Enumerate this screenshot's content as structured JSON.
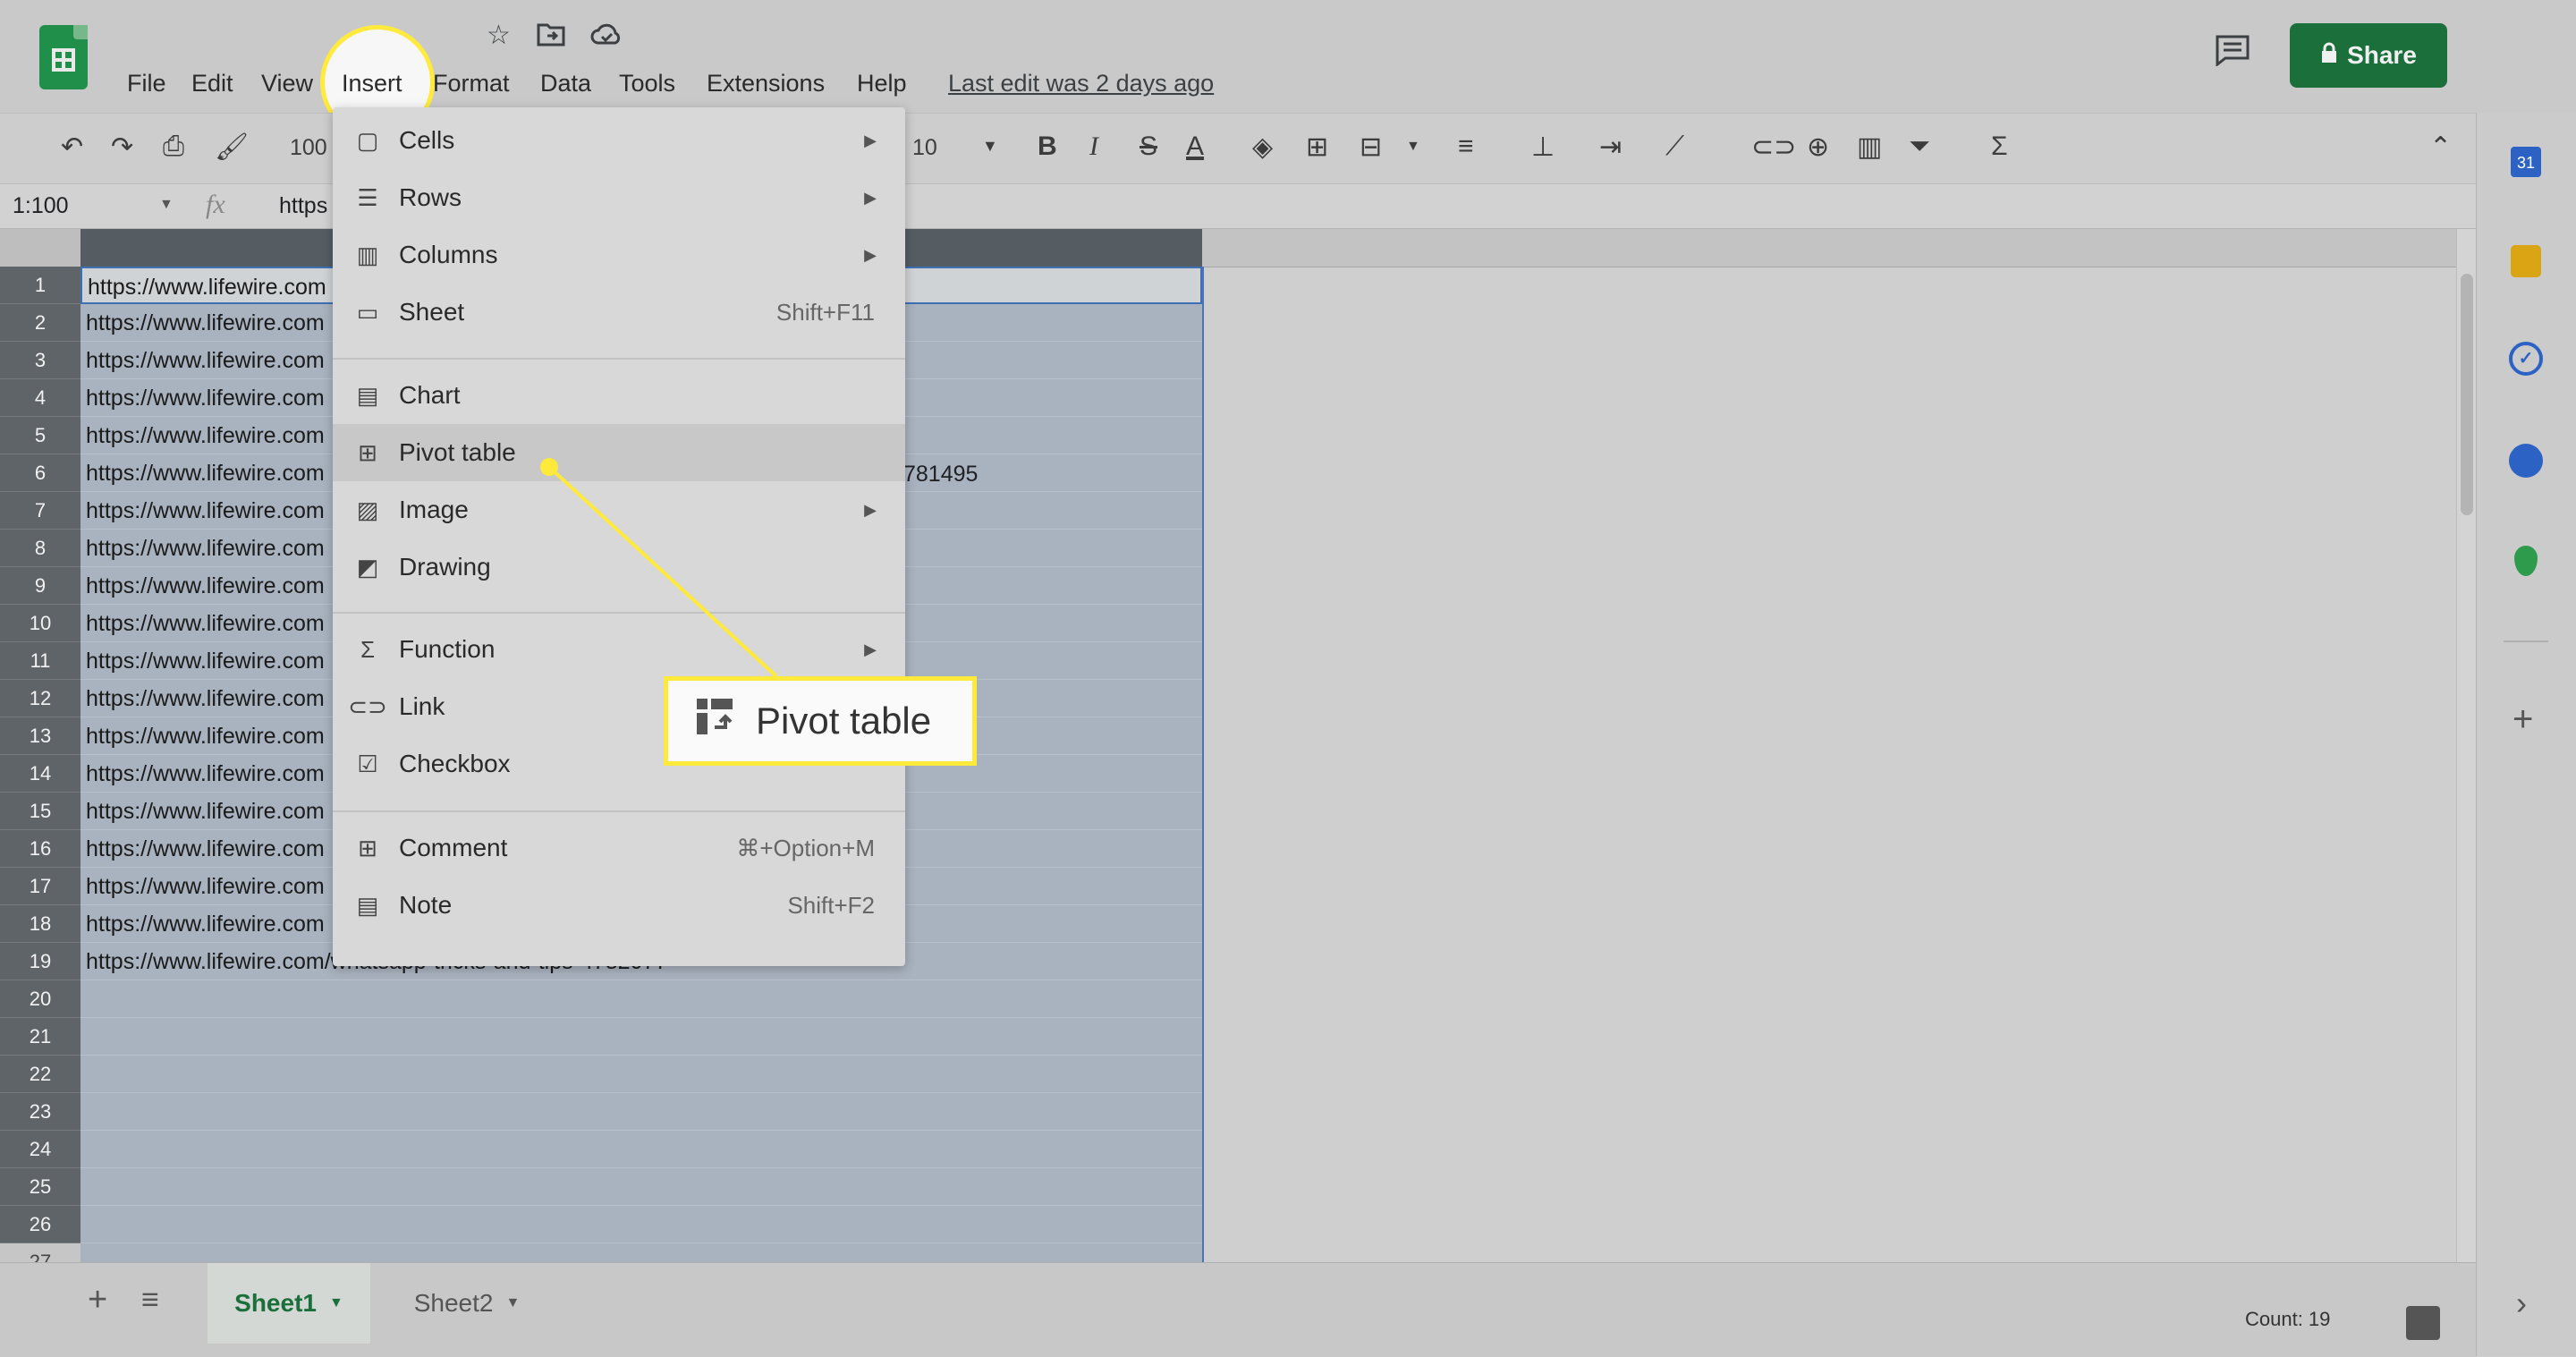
{
  "menubar": {
    "items": [
      "File",
      "Edit",
      "View",
      "Insert",
      "Format",
      "Data",
      "Tools",
      "Extensions",
      "Help"
    ],
    "last_edit": "Last edit was 2 days ago"
  },
  "share": {
    "label": "Share"
  },
  "toolbar": {
    "zoom": "100",
    "font_size": "10"
  },
  "formula_bar": {
    "name_box": "1:100",
    "fx": "fx",
    "content": "https"
  },
  "grid": {
    "rows": [
      "1",
      "2",
      "3",
      "4",
      "5",
      "6",
      "7",
      "8",
      "9",
      "10",
      "11",
      "12",
      "13",
      "14",
      "15",
      "16",
      "17",
      "18",
      "19",
      "20",
      "21",
      "22",
      "23",
      "24",
      "25",
      "26",
      "27"
    ],
    "cell_prefix": "https://www.lifewire.com",
    "row6_extra": "781495",
    "row19_value": "https://www.lifewire.com/whatsapp-tricks-and-tips-4782077"
  },
  "insert_menu": {
    "items": [
      {
        "label": "Cells",
        "shortcut": "",
        "submenu": true,
        "icon": "cells-icon"
      },
      {
        "label": "Rows",
        "shortcut": "",
        "submenu": true,
        "icon": "rows-icon"
      },
      {
        "label": "Columns",
        "shortcut": "",
        "submenu": true,
        "icon": "columns-icon"
      },
      {
        "label": "Sheet",
        "shortcut": "Shift+F11",
        "submenu": false,
        "icon": "sheet-icon"
      },
      {
        "label": "Chart",
        "shortcut": "",
        "submenu": false,
        "icon": "chart-icon"
      },
      {
        "label": "Pivot table",
        "shortcut": "",
        "submenu": false,
        "icon": "pivot-table-icon"
      },
      {
        "label": "Image",
        "shortcut": "",
        "submenu": true,
        "icon": "image-icon"
      },
      {
        "label": "Drawing",
        "shortcut": "",
        "submenu": false,
        "icon": "drawing-icon"
      },
      {
        "label": "Function",
        "shortcut": "",
        "submenu": true,
        "icon": "sigma-icon"
      },
      {
        "label": "Link",
        "shortcut": "",
        "submenu": false,
        "icon": "link-icon"
      },
      {
        "label": "Checkbox",
        "shortcut": "",
        "submenu": false,
        "icon": "checkbox-icon"
      },
      {
        "label": "Comment",
        "shortcut": "⌘+Option+M",
        "submenu": false,
        "icon": "comment-icon"
      },
      {
        "label": "Note",
        "shortcut": "Shift+F2",
        "submenu": false,
        "icon": "note-icon"
      }
    ]
  },
  "callout": {
    "label": "Pivot table"
  },
  "sheets": {
    "tabs": [
      "Sheet1",
      "Sheet2"
    ],
    "active": "Sheet1"
  },
  "status": {
    "count": "Count: 19"
  },
  "colors": {
    "highlight": "#ffea3d",
    "share_bg": "#1a6f3b",
    "selection": "#a9b2bf"
  }
}
